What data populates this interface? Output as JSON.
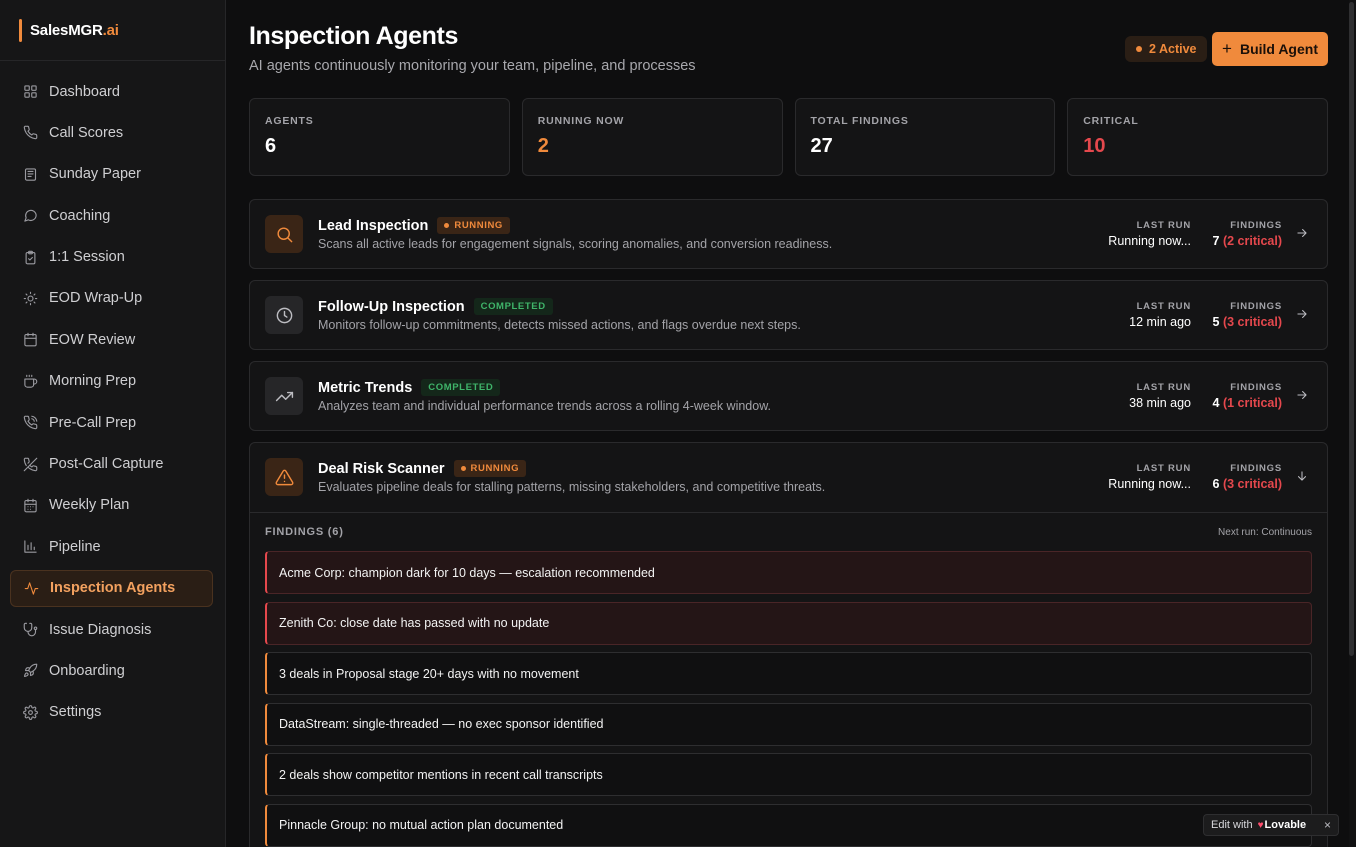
{
  "brand": {
    "name": "SalesMGR",
    "suffix": ".ai"
  },
  "sidebar": {
    "items": [
      {
        "label": "Dashboard",
        "icon": "grid-icon"
      },
      {
        "label": "Call Scores",
        "icon": "phone-icon"
      },
      {
        "label": "Sunday Paper",
        "icon": "newspaper-icon"
      },
      {
        "label": "Coaching",
        "icon": "message-icon"
      },
      {
        "label": "1:1 Session",
        "icon": "clipboard-icon"
      },
      {
        "label": "EOD Wrap-Up",
        "icon": "sun-icon"
      },
      {
        "label": "EOW Review",
        "icon": "calendar-icon"
      },
      {
        "label": "Morning Prep",
        "icon": "coffee-icon"
      },
      {
        "label": "Pre-Call Prep",
        "icon": "phone-call-icon"
      },
      {
        "label": "Post-Call Capture",
        "icon": "phone-off-icon"
      },
      {
        "label": "Weekly Plan",
        "icon": "calendar-days-icon"
      },
      {
        "label": "Pipeline",
        "icon": "bar-chart-icon"
      },
      {
        "label": "Inspection Agents",
        "icon": "activity-icon",
        "active": true
      },
      {
        "label": "Issue Diagnosis",
        "icon": "stethoscope-icon"
      },
      {
        "label": "Onboarding",
        "icon": "rocket-icon"
      },
      {
        "label": "Settings",
        "icon": "gear-icon"
      }
    ]
  },
  "header": {
    "title": "Inspection Agents",
    "subtitle": "AI agents continuously monitoring your team, pipeline, and processes",
    "active_count": "2 Active",
    "build_label": "Build Agent"
  },
  "stats": [
    {
      "label": "AGENTS",
      "value": "6"
    },
    {
      "label": "RUNNING NOW",
      "value": "2"
    },
    {
      "label": "TOTAL FINDINGS",
      "value": "27"
    },
    {
      "label": "CRITICAL",
      "value": "10"
    }
  ],
  "agents": [
    {
      "name": "Lead Inspection",
      "status": "RUNNING",
      "description": "Scans all active leads for engagement signals, scoring anomalies, and conversion readiness.",
      "last_run_label": "LAST RUN",
      "last_run": "Running now...",
      "findings_label": "FINDINGS",
      "findings_count": "7",
      "findings_critical": "(2 critical)",
      "icon": "search-icon"
    },
    {
      "name": "Follow-Up Inspection",
      "status": "COMPLETED",
      "description": "Monitors follow-up commitments, detects missed actions, and flags overdue next steps.",
      "last_run_label": "LAST RUN",
      "last_run": "12 min ago",
      "findings_label": "FINDINGS",
      "findings_count": "5",
      "findings_critical": "(3 critical)",
      "icon": "clock-icon"
    },
    {
      "name": "Metric Trends",
      "status": "COMPLETED",
      "description": "Analyzes team and individual performance trends across a rolling 4-week window.",
      "last_run_label": "LAST RUN",
      "last_run": "38 min ago",
      "findings_label": "FINDINGS",
      "findings_count": "4",
      "findings_critical": "(1 critical)",
      "icon": "trending-up-icon"
    },
    {
      "name": "Deal Risk Scanner",
      "status": "RUNNING",
      "description": "Evaluates pipeline deals for stalling patterns, missing stakeholders, and competitive threats.",
      "last_run_label": "LAST RUN",
      "last_run": "Running now...",
      "findings_label": "FINDINGS",
      "findings_count": "6",
      "findings_critical": "(3 critical)",
      "icon": "warning-icon"
    }
  ],
  "findings_panel": {
    "title": "FINDINGS (6)",
    "next_run": "Next run: Continuous",
    "items": [
      {
        "text": "Acme Corp: champion dark for 10 days — escalation recommended",
        "critical": true
      },
      {
        "text": "Zenith Co: close date has passed with no update",
        "critical": true
      },
      {
        "text": "3 deals in Proposal stage 20+ days with no movement",
        "critical": false
      },
      {
        "text": "DataStream: single-threaded — no exec sponsor identified",
        "critical": false
      },
      {
        "text": "2 deals show competitor mentions in recent call transcripts",
        "critical": false
      },
      {
        "text": "Pinnacle Group: no mutual action plan documented",
        "critical": false
      }
    ]
  },
  "edit_badge": {
    "prefix": "Edit with",
    "brand": "Lovable",
    "close": "×"
  },
  "colors": {
    "accent": "#f08a3c",
    "critical": "#e5484d",
    "success": "#3fb56a",
    "background": "#0e0e0f"
  }
}
